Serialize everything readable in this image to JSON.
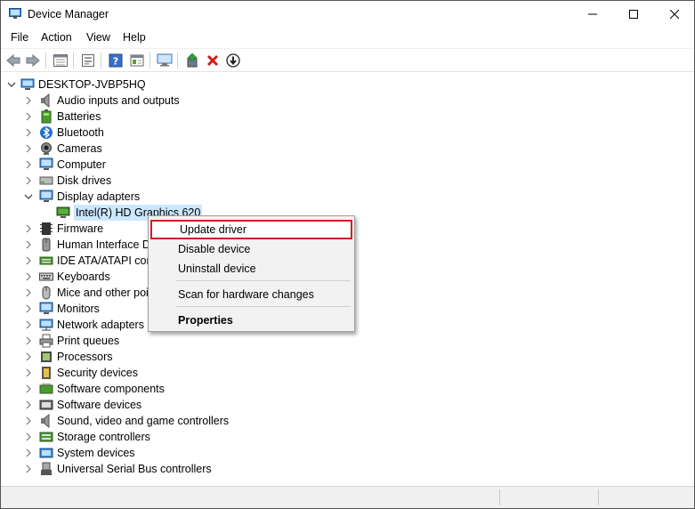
{
  "window": {
    "title": "Device Manager"
  },
  "menu": {
    "items": [
      "File",
      "Action",
      "View",
      "Help"
    ]
  },
  "toolbar": {
    "buttons": [
      "back-icon",
      "forward-icon",
      "properties-view-icon",
      "show-hidden-icon",
      "help-icon",
      "devices-by-type-icon",
      "scan-hardware-icon",
      "update-driver-icon",
      "uninstall-icon",
      "disable-icon"
    ]
  },
  "tree": {
    "root": "DESKTOP-JVBP5HQ",
    "categories": [
      {
        "label": "Audio inputs and outputs",
        "icon": "speaker-icon"
      },
      {
        "label": "Batteries",
        "icon": "battery-icon"
      },
      {
        "label": "Bluetooth",
        "icon": "bluetooth-icon"
      },
      {
        "label": "Cameras",
        "icon": "camera-icon"
      },
      {
        "label": "Computer",
        "icon": "computer-icon"
      },
      {
        "label": "Disk drives",
        "icon": "disk-icon"
      },
      {
        "label": "Display adapters",
        "icon": "monitor-icon",
        "expanded": true
      },
      {
        "label": "Firmware",
        "icon": "chip-icon"
      },
      {
        "label": "Human Interface D",
        "icon": "hid-icon"
      },
      {
        "label": "IDE ATA/ATAPI con",
        "icon": "ide-icon"
      },
      {
        "label": "Keyboards",
        "icon": "keyboard-icon"
      },
      {
        "label": "Mice and other poi",
        "icon": "mouse-icon"
      },
      {
        "label": "Monitors",
        "icon": "monitor-icon"
      },
      {
        "label": "Network adapters",
        "icon": "network-icon"
      },
      {
        "label": "Print queues",
        "icon": "printer-icon"
      },
      {
        "label": "Processors",
        "icon": "processor-icon"
      },
      {
        "label": "Security devices",
        "icon": "security-icon"
      },
      {
        "label": "Software components",
        "icon": "software-component-icon"
      },
      {
        "label": "Software devices",
        "icon": "software-device-icon"
      },
      {
        "label": "Sound, video and game controllers",
        "icon": "sound-icon"
      },
      {
        "label": "Storage controllers",
        "icon": "storage-icon"
      },
      {
        "label": "System devices",
        "icon": "system-icon"
      },
      {
        "label": "Universal Serial Bus controllers",
        "icon": "usb-icon"
      }
    ],
    "child_device": "Intel(R) HD Graphics 620"
  },
  "context_menu": {
    "items": [
      "Update driver",
      "Disable device",
      "Uninstall device",
      "Scan for hardware changes",
      "Properties"
    ],
    "highlighted": "Update driver",
    "highlight_color": "#d11a2a"
  },
  "colors": {
    "selection": "#cce8ff",
    "menu_bg": "#f2f2f2"
  }
}
